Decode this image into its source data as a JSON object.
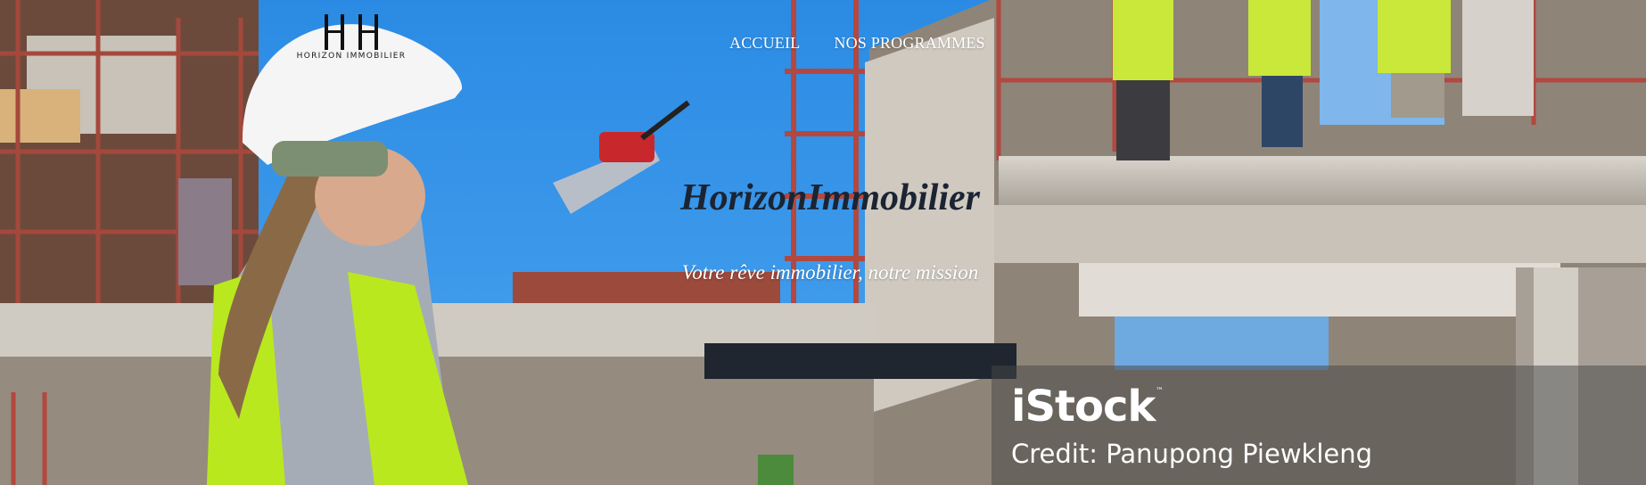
{
  "header": {
    "logo_text": "HORIZON IMMOBILIER",
    "nav": [
      {
        "label": "ACCUEIL"
      },
      {
        "label": "NOS PROGRAMMES"
      }
    ]
  },
  "hero": {
    "title": "HorizonImmobilier",
    "subtitle": "Votre rêve immobilier, notre mission"
  },
  "watermark": {
    "brand": "iStock",
    "trademark": "™",
    "credit": "Credit: Panupong Piewkleng"
  },
  "colors": {
    "sky": "#2f8fe6",
    "title": "#1b2433",
    "nav_text": "#ffffff"
  }
}
